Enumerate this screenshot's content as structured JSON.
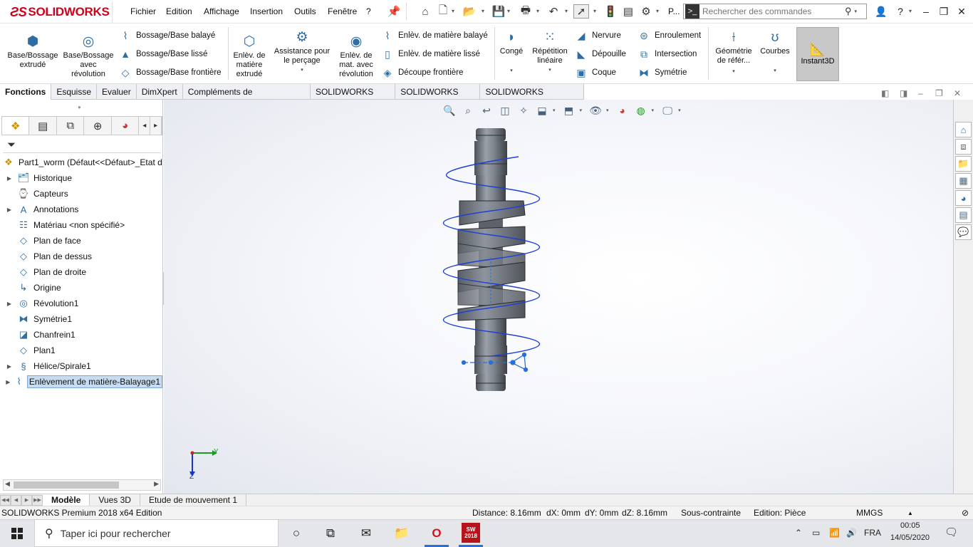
{
  "app": {
    "brand": "SOLIDWORKS",
    "menus": [
      "Fichier",
      "Edition",
      "Affichage",
      "Insertion",
      "Outils",
      "Fenêtre",
      "?"
    ],
    "toolbar_extra": "P...",
    "search_placeholder": "Rechercher des commandes"
  },
  "commands": {
    "base_bossage_extrude": "Base/Bossage\nextrudé",
    "base_bossage_revolution": "Base/Bossage\navec\nrévolution",
    "bossage_balaye": "Bossage/Base balayé",
    "bossage_lisse": "Bossage/Base lissé",
    "bossage_frontiere": "Bossage/Base frontière",
    "enlev_matiere_extrude": "Enlèv. de\nmatière\nextrudé",
    "assistance_percage": "Assistance pour\nle perçage",
    "enlev_revolution": "Enlèv. de\nmat. avec\nrévolution",
    "enlev_balaye": "Enlèv. de matière balayé",
    "enlev_lisse": "Enlèv. de matière lissé",
    "decoupe_frontiere": "Découpe frontière",
    "conge": "Congé",
    "repetition_lineaire": "Répétition\nlinéaire",
    "nervure": "Nervure",
    "depouille": "Dépouille",
    "coque": "Coque",
    "enroulement": "Enroulement",
    "intersection": "Intersection",
    "symetrie": "Symétrie",
    "geometrie_reference": "Géométrie\nde référ...",
    "courbes": "Courbes",
    "instant3d": "Instant3D"
  },
  "cmd_tabs": [
    "Fonctions",
    "Esquisse",
    "Evaluer",
    "DimXpert",
    "Compléments de SOLIDWORKS",
    "SOLIDWORKS MBD",
    "SOLIDWORKS CAM",
    "SOLIDWORKS Inspection"
  ],
  "feature_tree": {
    "root": "Part1_worm  (Défaut<<Défaut>_Etat d",
    "items": [
      {
        "label": "Historique",
        "expandable": true,
        "icon": "history-folder-icon"
      },
      {
        "label": "Capteurs",
        "expandable": false,
        "icon": "sensor-icon"
      },
      {
        "label": "Annotations",
        "expandable": true,
        "icon": "annotations-icon"
      },
      {
        "label": "Matériau <non spécifié>",
        "expandable": false,
        "icon": "material-icon"
      },
      {
        "label": "Plan de face",
        "expandable": false,
        "icon": "plane-icon"
      },
      {
        "label": "Plan de dessus",
        "expandable": false,
        "icon": "plane-icon"
      },
      {
        "label": "Plan de droite",
        "expandable": false,
        "icon": "plane-icon"
      },
      {
        "label": "Origine",
        "expandable": false,
        "icon": "origin-icon"
      },
      {
        "label": "Révolution1",
        "expandable": true,
        "icon": "revolve-icon"
      },
      {
        "label": "Symétrie1",
        "expandable": false,
        "icon": "mirror-icon"
      },
      {
        "label": "Chanfrein1",
        "expandable": false,
        "icon": "chamfer-icon"
      },
      {
        "label": "Plan1",
        "expandable": false,
        "icon": "plane-icon"
      },
      {
        "label": "Hélice/Spirale1",
        "expandable": true,
        "icon": "helix-icon"
      },
      {
        "label": "Enlèvement de matière-Balayage1",
        "expandable": true,
        "icon": "swept-cut-icon",
        "selected": true
      }
    ]
  },
  "triad": {
    "y": "Y",
    "z": "Z"
  },
  "bottom_tabs": [
    "Modèle",
    "Vues 3D",
    "Etude de mouvement 1"
  ],
  "status": {
    "edition": "SOLIDWORKS Premium 2018 x64 Edition",
    "distance": "Distance: 8.16mm",
    "dx": "dX: 0mm",
    "dy": "dY: 0mm",
    "dz": "dZ: 8.16mm",
    "constraint": "Sous-contrainte",
    "editing": "Edition: Pièce",
    "units": "MMGS"
  },
  "taskbar": {
    "search_placeholder": "Taper ici pour rechercher",
    "lang": "FRA",
    "time": "00:05",
    "date": "14/05/2020",
    "sw_badge": "2018"
  }
}
